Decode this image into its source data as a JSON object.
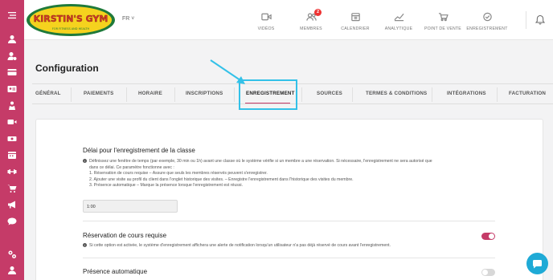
{
  "logo": {
    "name": "KIRSTIN'S GYM",
    "tagline": "FOR FITNESS AND HEALTH"
  },
  "language": "FR",
  "language_caret": "˅",
  "nav": [
    {
      "label": "VIDÉOS",
      "icon": "video-icon"
    },
    {
      "label": "MEMBRES",
      "icon": "members-icon",
      "badge": "2"
    },
    {
      "label": "CALENDRIER",
      "icon": "calendar-icon"
    },
    {
      "label": "ANALYTIQUE",
      "icon": "analytics-icon"
    },
    {
      "label": "POINT DE VENTE",
      "icon": "cart-icon"
    },
    {
      "label": "ENREGISTREMENT",
      "icon": "checkin-icon"
    }
  ],
  "page_title": "Configuration",
  "tabs": [
    "GÉNÉRAL",
    "PAIEMENTS",
    "HORAIRE",
    "INSCRIPTIONS",
    "ENREGISTREMENT",
    "SOURCES",
    "TERMES & CONDITIONS",
    "INTÉGRATIONS",
    "FACTURATION"
  ],
  "active_tab": "ENREGISTREMENT",
  "colors": {
    "sidebar": "#c53b68",
    "accent": "#c53b68",
    "highlight": "#33c1e8",
    "chat": "#1faad6"
  },
  "sections": {
    "checkin_delay": {
      "title": "Délai pour l'enregistrement de la classe",
      "info_lines": [
        "Définissez une fenêtre de temps (par exemple, 30 min ou 1h) avant une classe où le système vérifie si un membre a une réservation. Si nécessaire, l'enregistrement ne sera autorisé que",
        "dans ce délai. Ce paramètre fonctionne avec :",
        "1. Réservation de cours requise – Assure que seuls les membres réservés peuvent s'enregistrer.",
        "2. Ajouter une visite au profil du client dans l'onglet historique des visites. – Enregistre l'enregistrement dans l'historique des visites du membre.",
        "3. Présence automatique – Marque la présence lorsque l'enregistrement est réussi."
      ],
      "value": "1:00"
    },
    "booking_required": {
      "title": "Réservation de cours requise",
      "info": "Si cette option est activée, le système d'enregistrement affichera une alerte de notification lorsqu'un utilisateur n'a pas déjà réservé de cours avant l'enregistrement.",
      "enabled": true
    },
    "auto_attendance": {
      "title": "Présence automatique",
      "enabled": false
    }
  }
}
